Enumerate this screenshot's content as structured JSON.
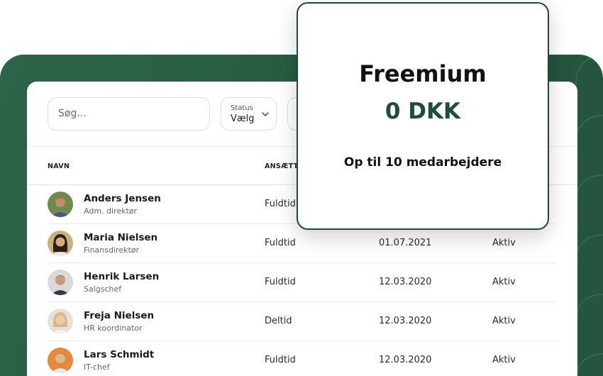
{
  "search": {
    "placeholder": "Søg..."
  },
  "status_filter": {
    "label": "Status",
    "value": "Vælg"
  },
  "table": {
    "columns": [
      "NAVN",
      "ANSÆTTE"
    ],
    "rows": [
      {
        "name": "Anders Jensen",
        "role": "Adm. direktør",
        "employment": "Fuldtid",
        "date": "",
        "status": ""
      },
      {
        "name": "Maria Nielsen",
        "role": "Finansdirektør",
        "employment": "Fuldtid",
        "date": "01.07.2021",
        "status": "Aktiv"
      },
      {
        "name": "Henrik Larsen",
        "role": "Salgschef",
        "employment": "Fuldtid",
        "date": "12.03.2020",
        "status": "Aktiv"
      },
      {
        "name": "Freja Nielsen",
        "role": "HR koordinator",
        "employment": "Deltid",
        "date": "12.03.2020",
        "status": "Aktiv"
      },
      {
        "name": "Lars Schmidt",
        "role": "IT-chef",
        "employment": "Fuldtid",
        "date": "12.03.2020",
        "status": "Aktiv"
      }
    ]
  },
  "plan_card": {
    "name": "Freemium",
    "price": "0 DKK",
    "description": "Op til 10 medarbejdere"
  },
  "colors": {
    "brand_green": "#24553e",
    "price_green": "#1f4e36"
  }
}
